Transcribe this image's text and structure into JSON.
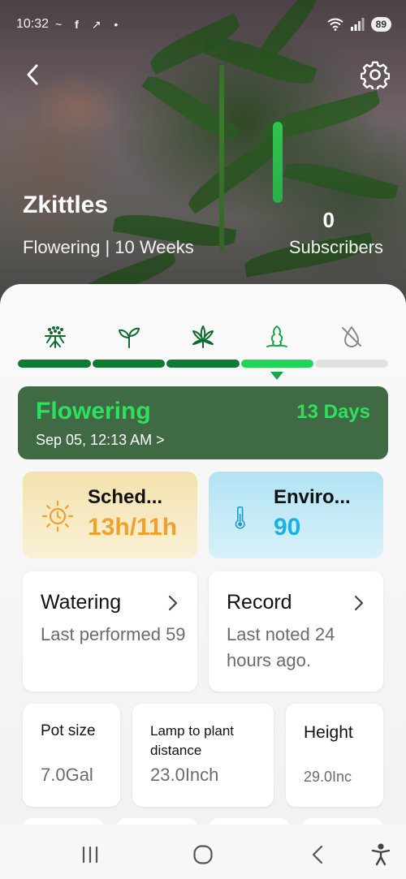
{
  "status_bar": {
    "time": "10:32",
    "notification_icons": [
      "~",
      "f",
      "↗",
      "•"
    ],
    "battery": "89"
  },
  "header": {
    "plant_name": "Zkittles",
    "subtitle": "Flowering | 10 Weeks",
    "subscribers_count": "0",
    "subscribers_label": "Subscribers"
  },
  "stages": {
    "icons": [
      "roots-icon",
      "seedling-icon",
      "vegetative-leaf-icon",
      "flowering-bud-icon",
      "harvest-disabled-icon"
    ],
    "completed": 3,
    "current_index": 3,
    "total": 5
  },
  "stage_card": {
    "title": "Flowering",
    "days": "13 Days",
    "date": "Sep 05, 12:13 AM >"
  },
  "schedule": {
    "label": "Sched...",
    "value": "13h/11h"
  },
  "environment": {
    "label": "Enviro...",
    "value": "90"
  },
  "watering": {
    "title": "Watering",
    "description": "Last performed 59"
  },
  "record": {
    "title": "Record",
    "description": "Last noted 24 hours ago."
  },
  "stats": {
    "pot_label": "Pot size",
    "pot_value": "7.0Gal",
    "lamp_label": "Lamp to plant distance",
    "lamp_value": "23.0Inch",
    "height_label": "Height",
    "height_value": "29.0Inc"
  },
  "colors": {
    "progress_done": "#0e7a33",
    "progress_current": "#22d35a",
    "stage_card_bg": "#3f6a44",
    "accent_green": "#2de15e",
    "schedule_value": "#f0a12c",
    "environment_value": "#1ab1e6"
  }
}
